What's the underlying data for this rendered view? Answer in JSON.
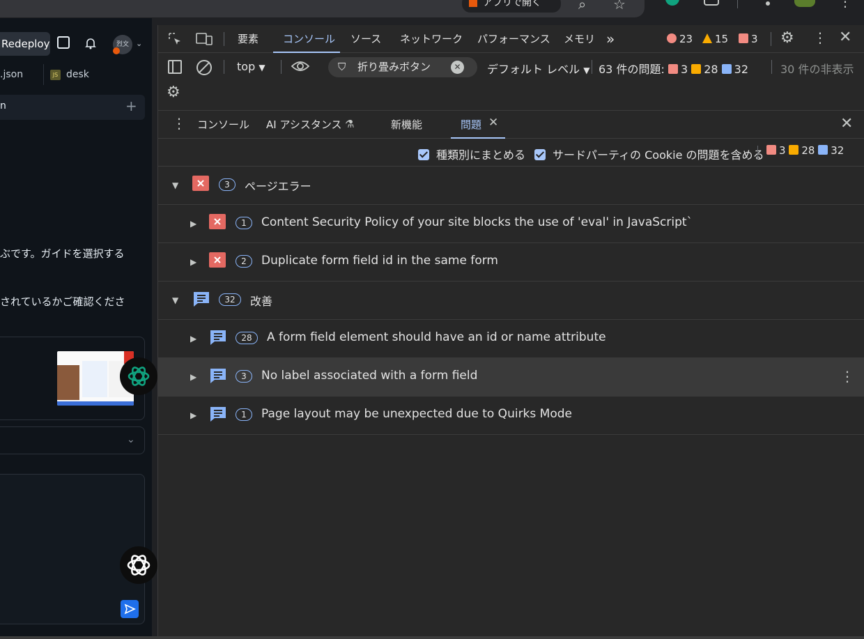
{
  "browser": {
    "open_in_app_label": "アプリで開く"
  },
  "left_panel": {
    "redeploy_label": "Redeploy",
    "avatar_text": "烈文",
    "file_tabs": [
      ".json",
      "desk"
    ],
    "row_label": "n",
    "text_line_1": "ぶです。ガイドを選択する",
    "text_line_2": "されているかご確認くださ"
  },
  "devtools": {
    "main_tabs": [
      "要素",
      "コンソール",
      "ソース",
      "ネットワーク",
      "パフォーマンス",
      "メモリ"
    ],
    "active_tab": "コンソール",
    "more_tabs": "»",
    "counts": {
      "errors": "23",
      "warnings": "15",
      "issues": "3"
    },
    "console_toolbar": {
      "context": "top",
      "filter_value": "折り畳みボタン",
      "level": "デフォルト レベル",
      "issues_label": "63 件の問題:",
      "issue_counts": {
        "red": "3",
        "orange": "28",
        "blue": "32"
      },
      "hidden": "30 件の非表示"
    },
    "drawer_tabs": [
      "コンソール",
      "AI アシスタンス",
      "新機能",
      "問題"
    ],
    "drawer_active": "問題",
    "options": {
      "group_by_kind": "種類別にまとめる",
      "third_party": "サードパーティの Cookie の問題を含める",
      "counts": {
        "red": "3",
        "orange": "28",
        "blue": "32"
      }
    },
    "groups": [
      {
        "label": "ページエラー",
        "count": "3",
        "kind": "error",
        "items": [
          {
            "count": "1",
            "text": "Content Security Policy of your site blocks the use of 'eval' in JavaScript`"
          },
          {
            "count": "2",
            "text": "Duplicate form field id in the same form"
          }
        ]
      },
      {
        "label": "改善",
        "count": "32",
        "kind": "improvement",
        "items": [
          {
            "count": "28",
            "text": "A form field element should have an id or name attribute"
          },
          {
            "count": "3",
            "text": "No label associated with a form field"
          },
          {
            "count": "1",
            "text": "Page layout may be unexpected due to Quirks Mode"
          }
        ]
      }
    ]
  },
  "colors": {
    "accent": "#a8c7fa",
    "error": "#e46962",
    "warning": "#f9ab00",
    "info": "#8ab4f8"
  }
}
